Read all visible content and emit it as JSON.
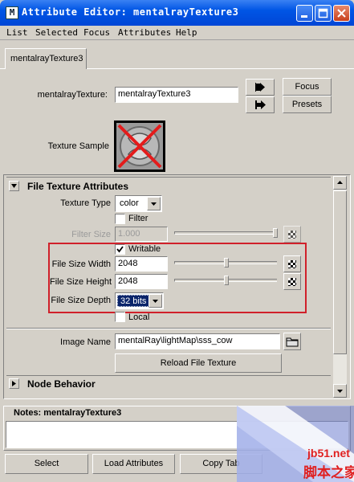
{
  "window": {
    "title": "Attribute Editor: mentalrayTexture3",
    "app_icon": "M"
  },
  "menu": [
    "List",
    "Selected",
    "Focus",
    "Attributes",
    "Help"
  ],
  "tab": {
    "label": "mentalrayTexture3"
  },
  "node": {
    "type_label": "mentalrayTexture:",
    "name_value": "mentalrayTexture3",
    "focus_label": "Focus",
    "presets_label": "Presets",
    "sample_label": "Texture Sample"
  },
  "section_file": {
    "title": "File Texture Attributes",
    "texture_type_label": "Texture Type",
    "texture_type_value": "color",
    "filter_label": "Filter",
    "filter_checked": false,
    "filter_size_label": "Filter Size",
    "filter_size_value": "1.000",
    "writable_label": "Writable",
    "writable_checked": true,
    "width_label": "File Size Width",
    "width_value": "2048",
    "height_label": "File Size Height",
    "height_value": "2048",
    "depth_label": "File Size Depth",
    "depth_value": "32 bits",
    "local_label": "Local",
    "local_checked": false,
    "image_name_label": "Image Name",
    "image_name_value": "mentalRay\\lightMap\\sss_cow",
    "reload_label": "Reload File Texture"
  },
  "section_node": {
    "title": "Node Behavior"
  },
  "notes": {
    "label": "Notes:  mentalrayTexture3"
  },
  "footer": {
    "select_label": "Select",
    "load_label": "Load Attributes",
    "copy_label": "Copy Tab"
  },
  "watermark": {
    "line1": "jb51.net",
    "line2": "脚本之家"
  },
  "colors": {
    "title_bar": "#0055e5",
    "highlight_box": "#d0202a",
    "selection": "#0a246a",
    "close_button": "#c8401c"
  }
}
